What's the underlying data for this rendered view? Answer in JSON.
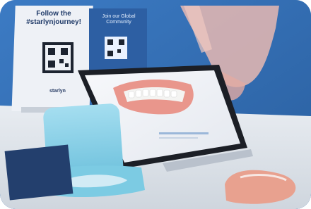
{
  "photo": {
    "left_sign": {
      "line1": "Follow the",
      "line2": "#starlynjourney!"
    },
    "right_sign": {
      "line1": "Join our Global",
      "line2": "Community"
    },
    "brand": "starlyn",
    "colors": {
      "backdrop": "#2f6fb6",
      "table": "#dfe4ea",
      "case": "#8fd3e8",
      "gum": "#e9968c",
      "tablet_frame": "#1c1f26"
    }
  }
}
